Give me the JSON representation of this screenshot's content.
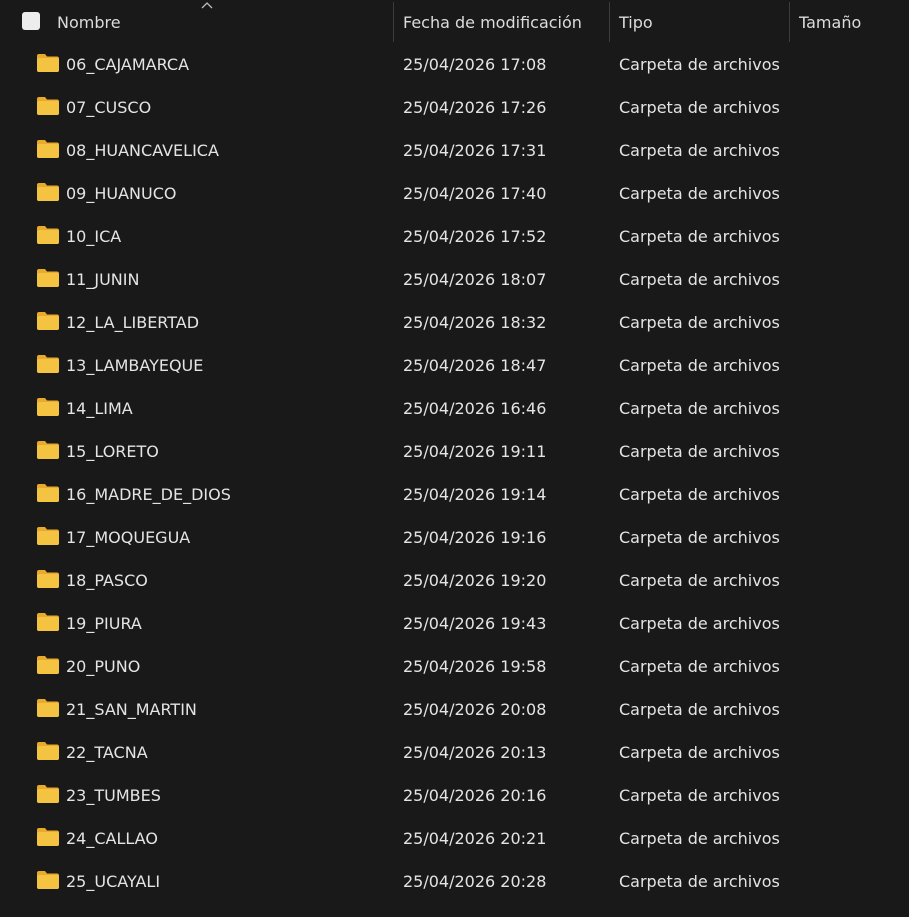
{
  "header": {
    "name": "Nombre",
    "date": "Fecha de modificación",
    "type": "Tipo",
    "size": "Tamaño"
  },
  "colors": {
    "background": "#191919",
    "folder": "#f4c342",
    "text": "#e4e4e4"
  },
  "rows": [
    {
      "name": "06_CAJAMARCA",
      "date": "25/04/2026 17:08",
      "type": "Carpeta de archivos"
    },
    {
      "name": "07_CUSCO",
      "date": "25/04/2026 17:26",
      "type": "Carpeta de archivos"
    },
    {
      "name": "08_HUANCAVELICA",
      "date": "25/04/2026 17:31",
      "type": "Carpeta de archivos"
    },
    {
      "name": "09_HUANUCO",
      "date": "25/04/2026 17:40",
      "type": "Carpeta de archivos"
    },
    {
      "name": "10_ICA",
      "date": "25/04/2026 17:52",
      "type": "Carpeta de archivos"
    },
    {
      "name": "11_JUNIN",
      "date": "25/04/2026 18:07",
      "type": "Carpeta de archivos"
    },
    {
      "name": "12_LA_LIBERTAD",
      "date": "25/04/2026 18:32",
      "type": "Carpeta de archivos"
    },
    {
      "name": "13_LAMBAYEQUE",
      "date": "25/04/2026 18:47",
      "type": "Carpeta de archivos"
    },
    {
      "name": "14_LIMA",
      "date": "25/04/2026 16:46",
      "type": "Carpeta de archivos"
    },
    {
      "name": "15_LORETO",
      "date": "25/04/2026 19:11",
      "type": "Carpeta de archivos"
    },
    {
      "name": "16_MADRE_DE_DIOS",
      "date": "25/04/2026 19:14",
      "type": "Carpeta de archivos"
    },
    {
      "name": "17_MOQUEGUA",
      "date": "25/04/2026 19:16",
      "type": "Carpeta de archivos"
    },
    {
      "name": "18_PASCO",
      "date": "25/04/2026 19:20",
      "type": "Carpeta de archivos"
    },
    {
      "name": "19_PIURA",
      "date": "25/04/2026 19:43",
      "type": "Carpeta de archivos"
    },
    {
      "name": "20_PUNO",
      "date": "25/04/2026 19:58",
      "type": "Carpeta de archivos"
    },
    {
      "name": "21_SAN_MARTIN",
      "date": "25/04/2026 20:08",
      "type": "Carpeta de archivos"
    },
    {
      "name": "22_TACNA",
      "date": "25/04/2026 20:13",
      "type": "Carpeta de archivos"
    },
    {
      "name": "23_TUMBES",
      "date": "25/04/2026 20:16",
      "type": "Carpeta de archivos"
    },
    {
      "name": "24_CALLAO",
      "date": "25/04/2026 20:21",
      "type": "Carpeta de archivos"
    },
    {
      "name": "25_UCAYALI",
      "date": "25/04/2026 20:28",
      "type": "Carpeta de archivos"
    }
  ]
}
